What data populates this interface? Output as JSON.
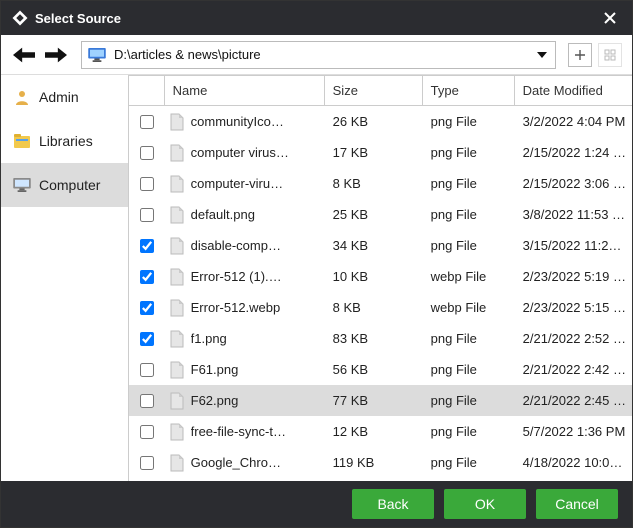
{
  "window": {
    "title": "Select Source"
  },
  "toolbar": {
    "path": "D:\\articles & news\\picture"
  },
  "sidebar": {
    "items": [
      {
        "label": "Admin",
        "icon": "user-admin-icon"
      },
      {
        "label": "Libraries",
        "icon": "libraries-icon"
      },
      {
        "label": "Computer",
        "icon": "computer-icon"
      }
    ],
    "selected_index": 2
  },
  "columns": {
    "name": "Name",
    "size": "Size",
    "type": "Type",
    "date": "Date Modified"
  },
  "files": [
    {
      "checked": false,
      "name": "communityIco…",
      "size": "26 KB",
      "type": "png File",
      "date": "3/2/2022 4:04 PM"
    },
    {
      "checked": false,
      "name": "computer virus…",
      "size": "17 KB",
      "type": "png File",
      "date": "2/15/2022 1:24 …"
    },
    {
      "checked": false,
      "name": "computer-viru…",
      "size": "8 KB",
      "type": "png File",
      "date": "2/15/2022 3:06 …"
    },
    {
      "checked": false,
      "name": "default.png",
      "size": "25 KB",
      "type": "png File",
      "date": "3/8/2022 11:53 …"
    },
    {
      "checked": true,
      "name": "disable-comp…",
      "size": "34 KB",
      "type": "png File",
      "date": "3/15/2022 11:2…"
    },
    {
      "checked": true,
      "name": "Error-512 (1).…",
      "size": "10 KB",
      "type": "webp File",
      "date": "2/23/2022 5:19 …"
    },
    {
      "checked": true,
      "name": "Error-512.webp",
      "size": "8 KB",
      "type": "webp File",
      "date": "2/23/2022 5:15 …"
    },
    {
      "checked": true,
      "name": "f1.png",
      "size": "83 KB",
      "type": "png File",
      "date": "2/21/2022 2:52 …"
    },
    {
      "checked": false,
      "name": "F61.png",
      "size": "56 KB",
      "type": "png File",
      "date": "2/21/2022 2:42 …"
    },
    {
      "checked": false,
      "name": "F62.png",
      "size": "77 KB",
      "type": "png File",
      "date": "2/21/2022 2:45 …",
      "hover": true
    },
    {
      "checked": false,
      "name": "free-file-sync-t…",
      "size": "12 KB",
      "type": "png File",
      "date": "5/7/2022 1:36 PM"
    },
    {
      "checked": false,
      "name": "Google_Chro…",
      "size": "119 KB",
      "type": "png File",
      "date": "4/18/2022 10:0…"
    }
  ],
  "buttons": {
    "back": "Back",
    "ok": "OK",
    "cancel": "Cancel"
  }
}
